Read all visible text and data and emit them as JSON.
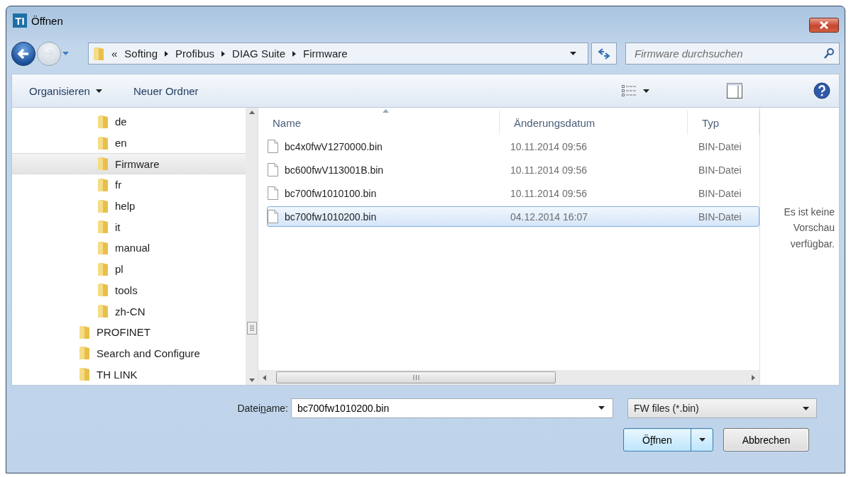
{
  "window": {
    "title": "Öffnen",
    "app_logo": "TI"
  },
  "address_bar": {
    "overflow": "«",
    "crumbs": [
      "Softing",
      "Profibus",
      "DIAG Suite",
      "Firmware"
    ]
  },
  "search": {
    "placeholder": "Firmware durchsuchen"
  },
  "toolbar": {
    "buttons": [
      "Organisieren",
      "Neuer Ordner"
    ]
  },
  "tree": {
    "nested_items": [
      {
        "label": "de",
        "selected": false
      },
      {
        "label": "en",
        "selected": false
      },
      {
        "label": "Firmware",
        "selected": true
      },
      {
        "label": "fr",
        "selected": false
      },
      {
        "label": "help",
        "selected": false
      },
      {
        "label": "it",
        "selected": false
      },
      {
        "label": "manual",
        "selected": false
      },
      {
        "label": "pl",
        "selected": false
      },
      {
        "label": "tools",
        "selected": false
      },
      {
        "label": "zh-CN",
        "selected": false
      }
    ],
    "items": [
      {
        "label": "PROFINET",
        "selected": false
      },
      {
        "label": "Search and Configure",
        "selected": false
      },
      {
        "label": "TH LINK",
        "selected": false
      }
    ]
  },
  "files": {
    "columns": [
      "Name",
      "Änderungsdatum",
      "Typ"
    ],
    "rows": [
      {
        "name": "bc4x0fwV1270000.bin",
        "date": "10.11.2014 09:56",
        "type": "BIN-Datei",
        "selected": false
      },
      {
        "name": "bc600fwV113001B.bin",
        "date": "10.11.2014 09:56",
        "type": "BIN-Datei",
        "selected": false
      },
      {
        "name": "bc700fw1010100.bin",
        "date": "10.11.2014 09:56",
        "type": "BIN-Datei",
        "selected": false
      },
      {
        "name": "bc700fw1010200.bin",
        "date": "04.12.2014 16:07",
        "type": "BIN-Datei",
        "selected": true
      }
    ]
  },
  "preview": {
    "message": "Es ist keine Vorschau verfügbar."
  },
  "filename": {
    "label": {
      "before": "Datei",
      "mnemonic": "n",
      "after": "ame:"
    },
    "value": "bc700fw1010200.bin"
  },
  "filter": {
    "value": "FW files (*.bin)"
  },
  "buttons": [
    {
      "kind": "split",
      "before": "Ö",
      "mnemonic": "f",
      "after": "fnen",
      "focused": true
    },
    {
      "kind": "plain",
      "before": "Abbrechen",
      "focused": false
    }
  ]
}
